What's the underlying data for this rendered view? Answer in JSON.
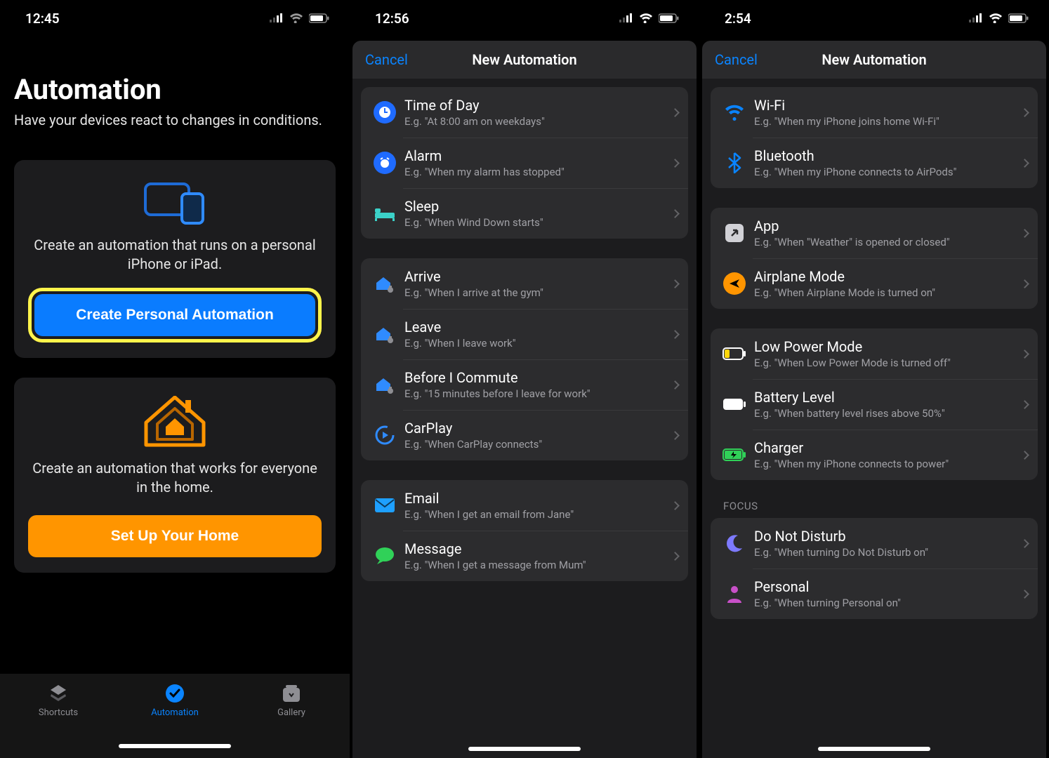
{
  "s1": {
    "time": "12:45",
    "title": "Automation",
    "subtitle": "Have your devices react to changes in conditions.",
    "personal_desc": "Create an automation that runs on a personal iPhone or iPad.",
    "personal_btn": "Create Personal Automation",
    "home_desc": "Create an automation that works for everyone in the home.",
    "home_btn": "Set Up Your Home",
    "tabs": {
      "shortcuts": "Shortcuts",
      "automation": "Automation",
      "gallery": "Gallery"
    }
  },
  "s2": {
    "time": "12:56",
    "cancel": "Cancel",
    "title": "New Automation",
    "g1": [
      {
        "title": "Time of Day",
        "sub": "E.g. \"At 8:00 am on weekdays\""
      },
      {
        "title": "Alarm",
        "sub": "E.g. \"When my alarm has stopped\""
      },
      {
        "title": "Sleep",
        "sub": "E.g. \"When Wind Down starts\""
      }
    ],
    "g2": [
      {
        "title": "Arrive",
        "sub": "E.g. \"When I arrive at the gym\""
      },
      {
        "title": "Leave",
        "sub": "E.g. \"When I leave work\""
      },
      {
        "title": "Before I Commute",
        "sub": "E.g. \"15 minutes before I leave for work\""
      },
      {
        "title": "CarPlay",
        "sub": "E.g. \"When CarPlay connects\""
      }
    ],
    "g3": [
      {
        "title": "Email",
        "sub": "E.g. \"When I get an email from Jane\""
      },
      {
        "title": "Message",
        "sub": "E.g. \"When I get a message from Mum\""
      }
    ]
  },
  "s3": {
    "time": "2:54",
    "cancel": "Cancel",
    "title": "New Automation",
    "g1": [
      {
        "title": "Wi-Fi",
        "sub": "E.g. \"When my iPhone joins home Wi-Fi\""
      },
      {
        "title": "Bluetooth",
        "sub": "E.g. \"When my iPhone connects to AirPods\""
      }
    ],
    "g2": [
      {
        "title": "App",
        "sub": "E.g. \"When \"Weather\" is opened or closed\""
      },
      {
        "title": "Airplane Mode",
        "sub": "E.g. \"When Airplane Mode is turned on\""
      }
    ],
    "g3": [
      {
        "title": "Low Power Mode",
        "sub": "E.g. \"When Low Power Mode is turned off\""
      },
      {
        "title": "Battery Level",
        "sub": "E.g. \"When battery level rises above 50%\""
      },
      {
        "title": "Charger",
        "sub": "E.g. \"When my iPhone connects to power\""
      }
    ],
    "focus_header": "Focus",
    "g4": [
      {
        "title": "Do Not Disturb",
        "sub": "E.g. \"When turning Do Not Disturb on\""
      },
      {
        "title": "Personal",
        "sub": "E.g. \"When turning Personal on\""
      }
    ]
  }
}
